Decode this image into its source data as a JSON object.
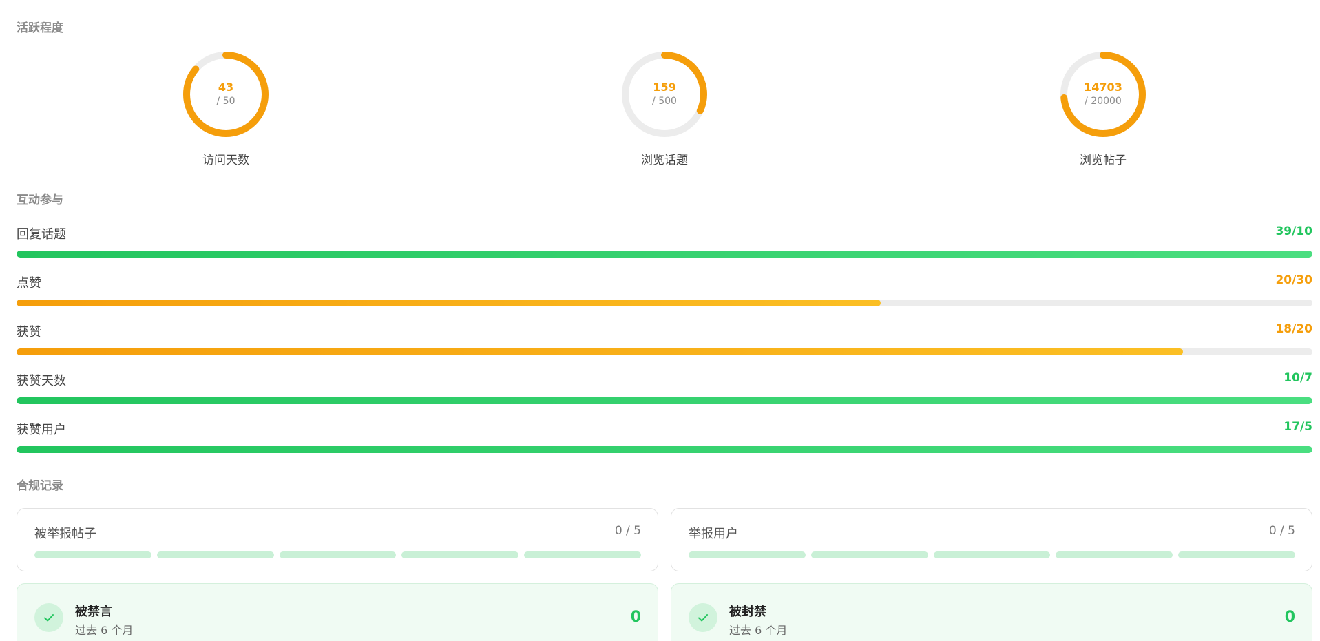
{
  "activity": {
    "title": "活跃程度",
    "rings": [
      {
        "value": 43,
        "target": 50,
        "target_text": "/ 50",
        "label": "访问天数",
        "progress": 0.86
      },
      {
        "value": 159,
        "target": 500,
        "target_text": "/ 500",
        "label": "浏览话题",
        "progress": 0.318
      },
      {
        "value": 14703,
        "target": 20000,
        "target_text": "/ 20000",
        "label": "浏览帖子",
        "progress": 0.735
      }
    ],
    "ring_color": "#f59e0b",
    "ring_track_color": "#ececec"
  },
  "interaction": {
    "title": "互动参与",
    "bars": [
      {
        "label": "回复话题",
        "count_text": "39/10",
        "value": 39,
        "target": 10,
        "progress": 1.0,
        "status": "met"
      },
      {
        "label": "点赞",
        "count_text": "20/30",
        "value": 20,
        "target": 30,
        "progress": 0.667,
        "status": "unmet"
      },
      {
        "label": "获赞",
        "count_text": "18/20",
        "value": 18,
        "target": 20,
        "progress": 0.9,
        "status": "unmet"
      },
      {
        "label": "获赞天数",
        "count_text": "10/7",
        "value": 10,
        "target": 7,
        "progress": 1.0,
        "status": "met"
      },
      {
        "label": "获赞用户",
        "count_text": "17/5",
        "value": 17,
        "target": 5,
        "progress": 1.0,
        "status": "met"
      }
    ],
    "met_color": "#22c55e",
    "unmet_color": "#f59e0b"
  },
  "compliance": {
    "title": "合规记录",
    "limits": [
      {
        "title": "被举报帖子",
        "count_text": "0 / 5",
        "value": 0,
        "max": 5
      },
      {
        "title": "举报用户",
        "count_text": "0 / 5",
        "value": 0,
        "max": 5
      }
    ],
    "statuses": [
      {
        "title": "被禁言",
        "subtitle": "过去 6 个月",
        "value": "0",
        "icon": "check-icon"
      },
      {
        "title": "被封禁",
        "subtitle": "过去 6 个月",
        "value": "0",
        "icon": "check-icon"
      }
    ],
    "ok_color": "#22c55e"
  }
}
